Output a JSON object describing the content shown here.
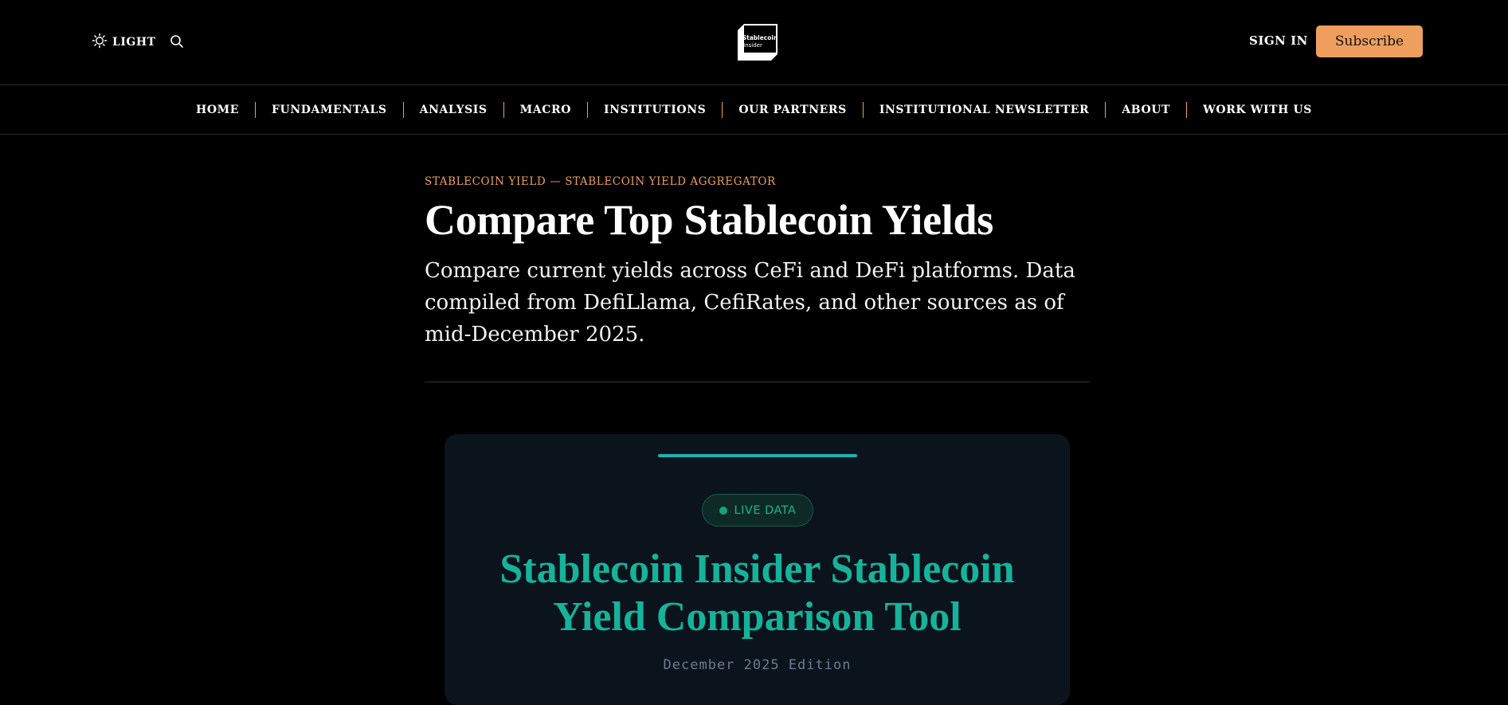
{
  "header": {
    "theme_toggle_label": "LIGHT",
    "logo": {
      "text_line1": "Stablecoin",
      "text_line2": "Insider"
    },
    "sign_in_label": "SIGN IN",
    "subscribe_label": "Subscribe"
  },
  "nav": {
    "items": [
      {
        "label": "HOME"
      },
      {
        "label": "FUNDAMENTALS"
      },
      {
        "label": "ANALYSIS"
      },
      {
        "label": "MACRO"
      },
      {
        "label": "INSTITUTIONS"
      },
      {
        "label": "OUR PARTNERS"
      },
      {
        "label": "INSTITUTIONAL NEWSLETTER"
      },
      {
        "label": "ABOUT"
      },
      {
        "label": "WORK WITH US"
      }
    ]
  },
  "hero": {
    "kicker": "STABLECOIN YIELD — STABLECOIN YIELD AGGREGATOR",
    "title": "Compare Top Stablecoin Yields",
    "intro": "Compare current yields across CeFi and DeFi platforms. Data compiled from DefiLlama, CefiRates, and other sources as of mid-December 2025."
  },
  "card": {
    "badge_label": "LIVE DATA",
    "title_line1": "Stablecoin Insider Stablecoin",
    "title_line2": "Yield Comparison Tool",
    "edition": "December 2025 Edition"
  },
  "colors": {
    "background": "#000000",
    "accent_orange": "#ee9f5e",
    "card_background": "#0b131c",
    "teal": "#16b39a",
    "live_green": "#1fb389"
  },
  "icons": {
    "theme": "sun-icon",
    "search": "search-icon"
  }
}
